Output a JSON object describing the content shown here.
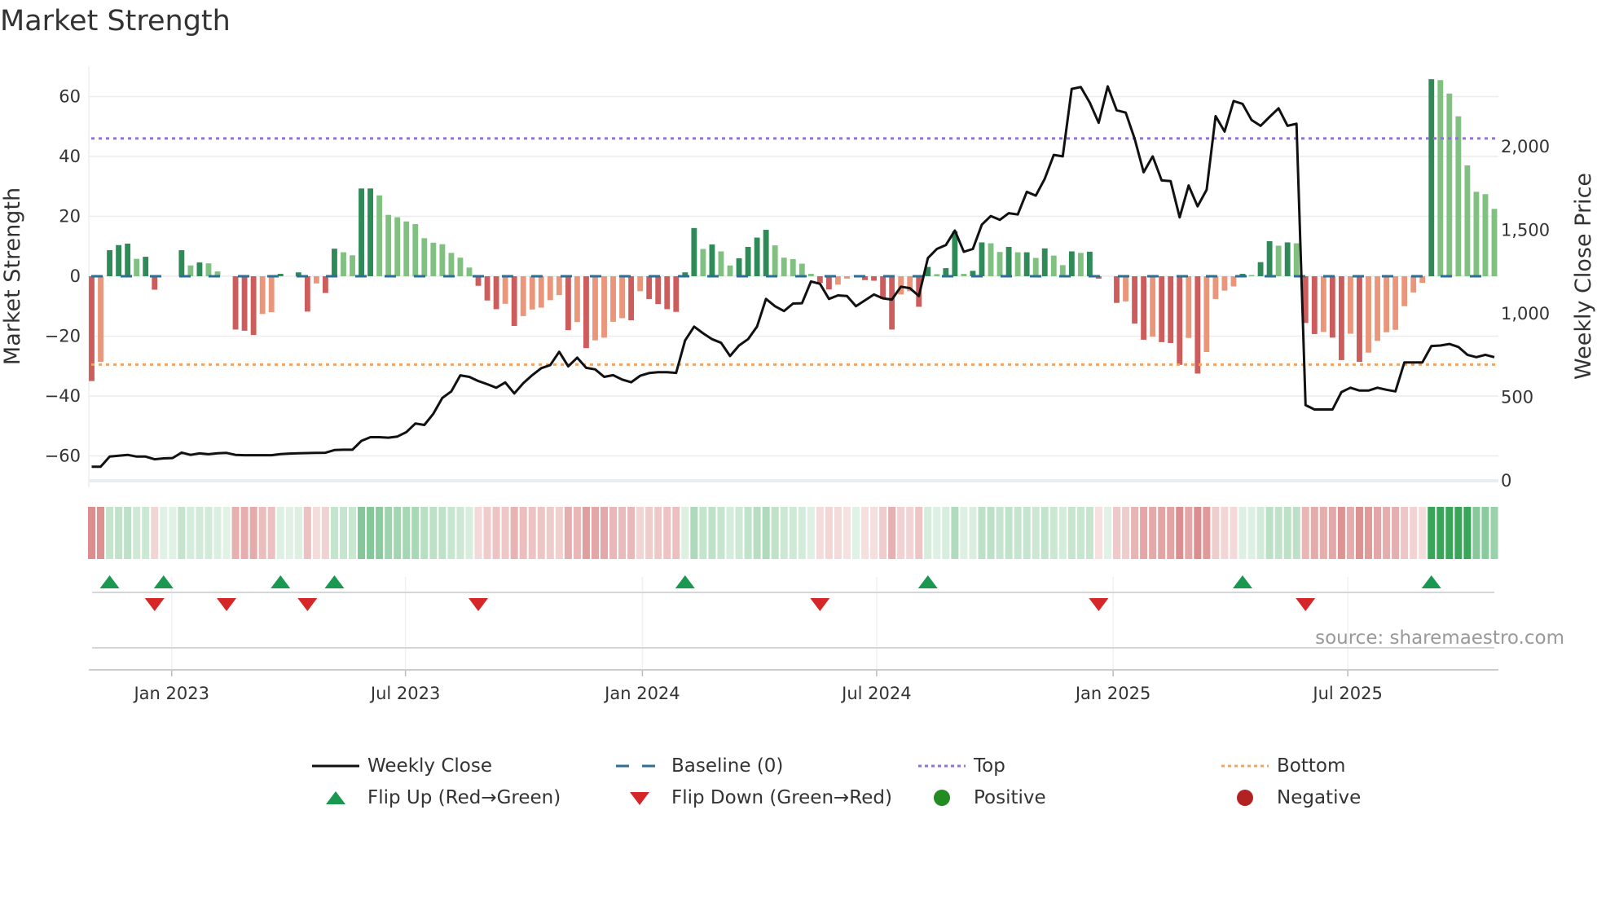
{
  "title": "Market Strength",
  "source": "source: sharemaestro.com",
  "colors": {
    "pos_dark": "#2e8b57",
    "pos_light": "#80c080",
    "neg_dark": "#cd5c5c",
    "neg_light": "#e9967a",
    "price": "#111111",
    "baseline": "#2a6f97",
    "top": "#9370db",
    "bottom": "#f4a460",
    "flip_up": "#1a9850",
    "flip_down": "#d62728",
    "positive": "#228b22",
    "negative": "#b22222",
    "grid": "#ececec"
  },
  "legend": [
    {
      "label": "Weekly Close",
      "icon": "line-icon"
    },
    {
      "label": "Baseline (0)",
      "icon": "dashed-line-icon"
    },
    {
      "label": "Top",
      "icon": "dotted-line-icon"
    },
    {
      "label": "Bottom",
      "icon": "dotted-line-icon"
    },
    {
      "label": "Flip Up (Red→Green)",
      "icon": "triangle-up-icon"
    },
    {
      "label": "Flip Down (Green→Red)",
      "icon": "triangle-down-icon"
    },
    {
      "label": "Positive",
      "icon": "circle-icon"
    },
    {
      "label": "Negative",
      "icon": "circle-icon"
    }
  ],
  "chart_data": {
    "type": "bar",
    "title": "Market Strength",
    "ylabel": "Market Strength",
    "y2label": "Weekly Close Price",
    "ylim": [
      -68.3,
      70.2
    ],
    "y2lim": [
      0,
      2483
    ],
    "yticks": [
      60,
      40,
      20,
      0,
      -20,
      -40,
      -60
    ],
    "ytick_labels": [
      "60",
      "40",
      "20",
      "0",
      "−20",
      "−40",
      "−60"
    ],
    "y2ticks": [
      2000,
      1500,
      1000,
      500,
      0
    ],
    "y2tick_labels": [
      "2,000",
      "1,500",
      "1,000",
      "500",
      "0"
    ],
    "x_ticks": [
      {
        "label": "Jan 2023",
        "week": 9.9
      },
      {
        "label": "Jul 2023",
        "week": 35.9
      },
      {
        "label": "Jan 2024",
        "week": 62.25
      },
      {
        "label": "Jul 2024",
        "week": 88.3
      },
      {
        "label": "Jan 2025",
        "week": 114.6
      },
      {
        "label": "Jul 2025",
        "week": 140.7
      }
    ],
    "top_level": 46,
    "bottom_level": -29.5,
    "baseline": 0,
    "grid": true,
    "legend_position": "bottom",
    "strength": [
      -35,
      -28.6,
      8.7,
      10.4,
      10.9,
      5.8,
      6.5,
      -4.5,
      0,
      0,
      8.7,
      3.6,
      4.6,
      4.3,
      1.6,
      0,
      -17.8,
      -18.2,
      -19.6,
      -12.6,
      -12,
      0.8,
      0,
      1.3,
      -11.8,
      -2.4,
      -5.6,
      9.2,
      8,
      7,
      29.3,
      29.3,
      27,
      20.5,
      19.7,
      18.3,
      17.4,
      12.7,
      11.2,
      10.7,
      7.8,
      6.2,
      2.9,
      -3.2,
      -8.1,
      -11,
      -9.2,
      -16.6,
      -13.3,
      -11.1,
      -10.5,
      -8,
      -6.3,
      -18,
      -15.3,
      -24,
      -21.4,
      -20.5,
      -15.2,
      -14,
      -14.7,
      -5,
      -7.6,
      -9.3,
      -11,
      -11.9,
      1.3,
      16.1,
      9.1,
      10.6,
      8.3,
      3.6,
      6,
      9.8,
      12.9,
      15.5,
      10.3,
      6.2,
      5.7,
      4.2,
      0.8,
      -2.2,
      -4.4,
      -2.8,
      -0.8,
      0,
      -1.3,
      -1.5,
      -7.6,
      -17.8,
      -6.1,
      -5,
      -10.2,
      3.1,
      0.7,
      2.7,
      15,
      0.8,
      1.8,
      11.3,
      11,
      8.1,
      9.8,
      8,
      8,
      6.1,
      9.3,
      6.9,
      3.7,
      8.3,
      7.8,
      8.2,
      -0.8,
      0,
      -8.9,
      -8.4,
      -15.8,
      -21.2,
      -20.2,
      -22,
      -22.3,
      -29.6,
      -20.6,
      -32.5,
      -25.3,
      -7.6,
      -4.8,
      -3.4,
      0.8,
      0.4,
      4.7,
      11.7,
      10.2,
      11.3,
      11,
      -15.6,
      -19.3,
      -18.6,
      -20.5,
      -28,
      -19.2,
      -28.6,
      -25.5,
      -21.6,
      -18.7,
      -17.9,
      -10,
      -5.4,
      -2.2,
      65.8,
      65.5,
      61,
      53.4,
      37,
      28.2,
      27.4,
      22.5
    ],
    "weekly_close": [
      84,
      84,
      145,
      150,
      155,
      145,
      145,
      129,
      134,
      136,
      169,
      155,
      164,
      159,
      165,
      167,
      155,
      153,
      153,
      153,
      153,
      160,
      163,
      165,
      166,
      167,
      168,
      184,
      186,
      186,
      239,
      261,
      261,
      258,
      265,
      291,
      343,
      334,
      401,
      496,
      535,
      631,
      622,
      597,
      578,
      557,
      589,
      523,
      584,
      632,
      674,
      692,
      772,
      685,
      737,
      676,
      667,
      622,
      632,
      606,
      590,
      629,
      645,
      650,
      650,
      646,
      840,
      923,
      883,
      848,
      826,
      747,
      810,
      848,
      923,
      1089,
      1045,
      1016,
      1061,
      1063,
      1193,
      1179,
      1089,
      1110,
      1106,
      1045,
      1080,
      1115,
      1092,
      1085,
      1162,
      1153,
      1106,
      1333,
      1388,
      1411,
      1498,
      1371,
      1388,
      1533,
      1585,
      1562,
      1602,
      1594,
      1730,
      1707,
      1808,
      1951,
      1942,
      2346,
      2357,
      2265,
      2143,
      2361,
      2218,
      2204,
      2047,
      1847,
      1942,
      1798,
      1794,
      1577,
      1768,
      1643,
      1742,
      2183,
      2091,
      2273,
      2256,
      2160,
      2125,
      2178,
      2230,
      2125,
      2137,
      453,
      427,
      427,
      427,
      531,
      557,
      540,
      540,
      557,
      545,
      535,
      709,
      709,
      709,
      807,
      810,
      819,
      801,
      754,
      740,
      754,
      740
    ],
    "flip_up_weeks": [
      3,
      9,
      22,
      28,
      67,
      94,
      129,
      150
    ],
    "flip_down_weeks": [
      8,
      16,
      25,
      44,
      82,
      113,
      136
    ]
  }
}
